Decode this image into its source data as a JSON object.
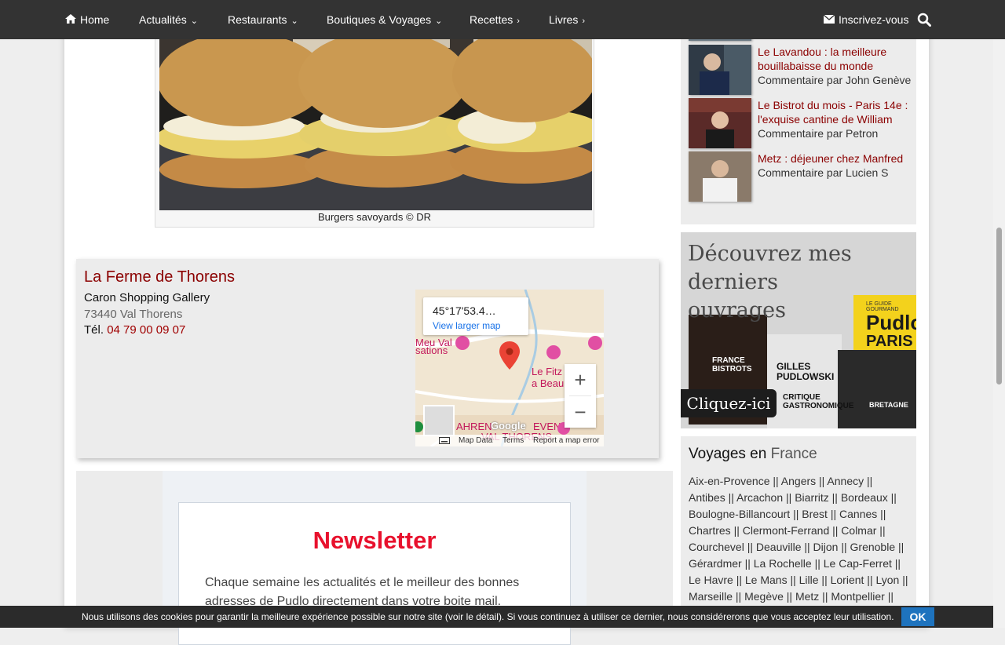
{
  "nav": {
    "home": "Home",
    "actualites": "Actualités",
    "restaurants": "Restaurants",
    "boutiques": "Boutiques & Voyages",
    "recettes": "Recettes",
    "livres": "Livres",
    "subscribe": "Inscrivez-vous"
  },
  "photo": {
    "caption": "Burgers savoyards © DR"
  },
  "restaurant": {
    "name": "La Ferme de Thorens",
    "street": "Caron Shopping Gallery",
    "city": "73440 Val Thorens",
    "tel_label": "Tél.",
    "tel": "04 79 00 09 07"
  },
  "map": {
    "coords": "45°17'53.4…",
    "larger_link": "View larger map",
    "zoom_in": "+",
    "zoom_out": "−",
    "map_data": "Map Data",
    "terms": "Terms",
    "report": "Report a map error",
    "google": "Google",
    "labels": {
      "fitz": "Le Fitz",
      "beau": "a Beau",
      "meu": "Meu Val",
      "sations": "sations",
      "hren": "AHREN",
      "even": "EVEN",
      "valthorens": "VAL THORENS"
    }
  },
  "newsletter": {
    "title": "Newsletter",
    "text": "Chaque semaine les actualités et le meilleur des bonnes adresses de Pudlo directement dans votre boite mail."
  },
  "comments": [
    {
      "title": "Le Lavandou : la meilleure bouillabaisse du monde",
      "by": "Commentaire par John Genève"
    },
    {
      "title": "Le Bistrot du mois - Paris 14e : l'exquise cantine de William",
      "by": "Commentaire par Petron"
    },
    {
      "title": "Metz : déjeuner chez Manfred",
      "by": "Commentaire par Lucien S"
    }
  ],
  "ad": {
    "headline": "Découvrez mes derniers ouvrages",
    "cta": "Cliquez-ici",
    "book1": "FRANCE BISTROTS",
    "book2": "GILLES PUDLOWSKI",
    "book2b": "CRITIQUE GASTRONOMIQUE",
    "book3": "BRETAGNE",
    "book4": "Pudlo",
    "book4b": "PARIS",
    "book4c": "LE GUIDE GOURMAND"
  },
  "voyages": {
    "title_prefix": "Voyages en",
    "title_country": "France",
    "cities": [
      "Aix-en-Provence",
      "Angers",
      "Annecy",
      "Antibes",
      "Arcachon",
      "Biarritz",
      "Bordeaux",
      "Boulogne-Billancourt",
      "Brest",
      "Cannes",
      "Chartres",
      "Clermont-Ferrand",
      "Colmar",
      "Courchevel",
      "Deauville",
      "Dijon",
      "Grenoble",
      "Gérardmer",
      "La Rochelle",
      "Le Cap-Ferret",
      "Le Havre",
      "Le Mans",
      "Lille",
      "Lorient",
      "Lyon",
      "Marseille",
      "Megève",
      "Metz",
      "Montpellier"
    ],
    "separator": " || "
  },
  "cookie": {
    "text_before": "Nous utilisons des cookies pour garantir la meilleure expérience possible sur notre site (",
    "link": "voir le détail",
    "text_after": "). Si vous continuez à utiliser ce dernier, nous considérerons que vous acceptez leur utilisation.",
    "ok": "OK"
  },
  "colors": {
    "nav_bg": "#333333",
    "accent_red": "#8b0000",
    "newsletter_red": "#e8112d",
    "ok_blue": "#1e73be"
  }
}
